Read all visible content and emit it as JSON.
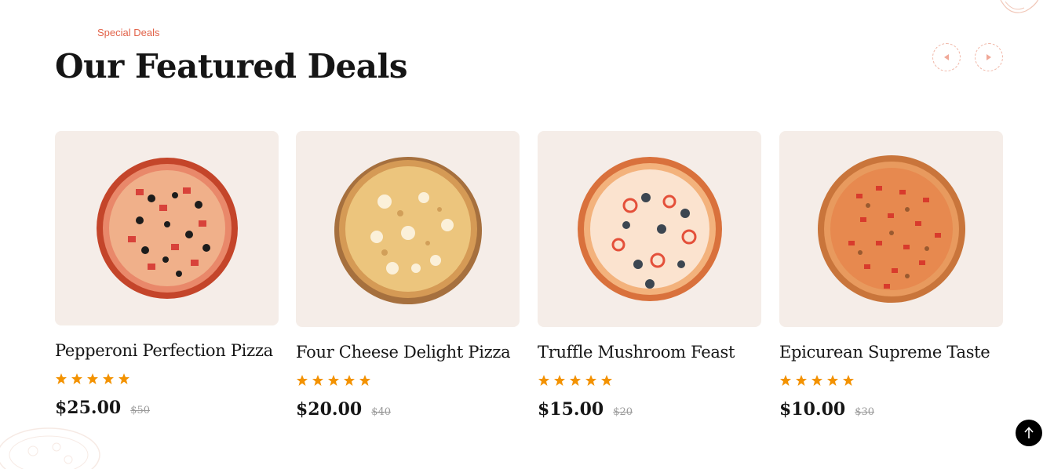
{
  "section": {
    "eyebrow": "Special Deals",
    "title": "Our Featured Deals"
  },
  "carousel": {
    "prev_icon": "triangle-left-icon",
    "next_icon": "triangle-right-icon"
  },
  "products": [
    {
      "name": "Pepperoni Perfection Pizza",
      "price": "$25.00",
      "old_price": "$50",
      "rating": 5,
      "image": "pepperoni-pizza"
    },
    {
      "name": "Four Cheese Delight Pizza",
      "price": "$20.00",
      "old_price": "$40",
      "rating": 5,
      "image": "four-cheese-pizza"
    },
    {
      "name": "Truffle Mushroom Feast",
      "price": "$15.00",
      "old_price": "$20",
      "rating": 5,
      "image": "truffle-mushroom-pizza"
    },
    {
      "name": "Epicurean Supreme Taste",
      "price": "$10.00",
      "old_price": "$30",
      "rating": 5,
      "image": "supreme-pizza"
    }
  ],
  "colors": {
    "accent": "#e2634a",
    "star": "#f39200",
    "card_bg": "#f5ede8"
  },
  "scroll_top_icon": "arrow-up-icon"
}
